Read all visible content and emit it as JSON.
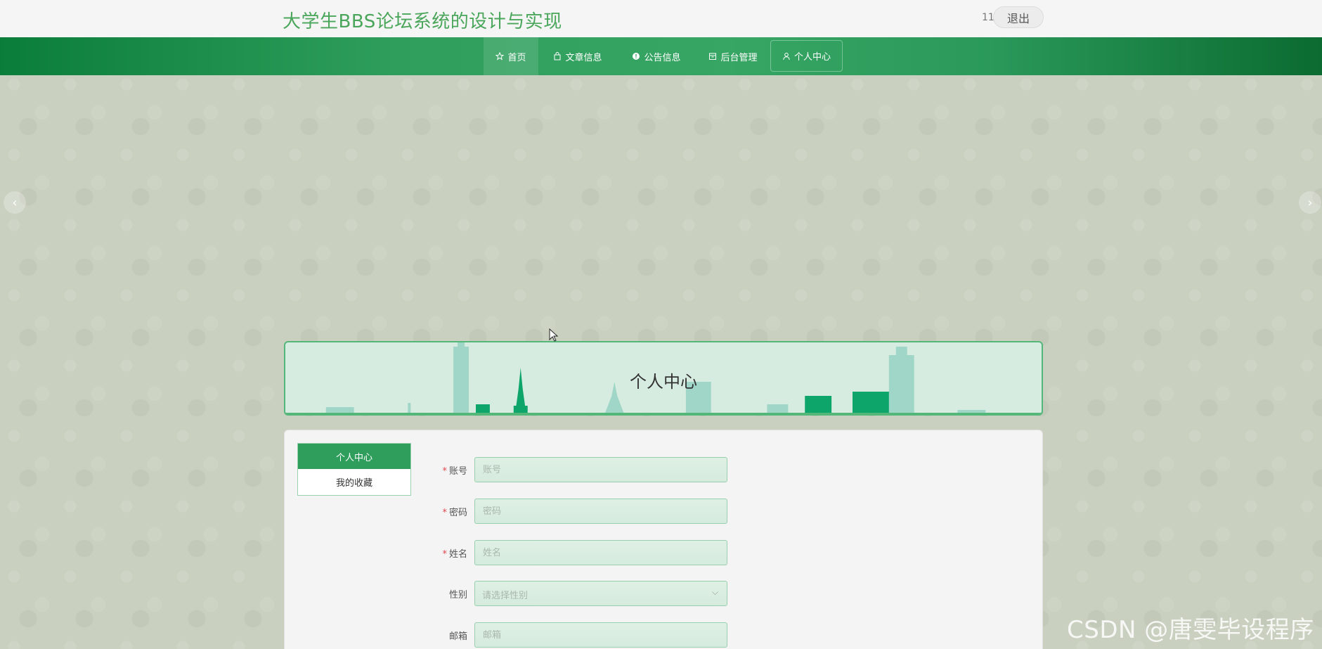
{
  "header": {
    "site_title": "大学生BBS论坛系统的设计与实现",
    "user_num": "11",
    "logout_label": "退出"
  },
  "nav": {
    "items": [
      {
        "label": "首页",
        "icon": "star-icon"
      },
      {
        "label": "文章信息",
        "icon": "bag-icon"
      },
      {
        "label": "公告信息",
        "icon": "info-icon"
      },
      {
        "label": "后台管理",
        "icon": "box-icon"
      },
      {
        "label": "个人中心",
        "icon": "user-icon"
      }
    ]
  },
  "carousel": {
    "prev": "‹",
    "next": "›"
  },
  "banner": {
    "title": "个人中心"
  },
  "side_menu": {
    "items": [
      "个人中心",
      "我的收藏"
    ]
  },
  "form": {
    "account": {
      "label": "账号",
      "placeholder": "账号",
      "required": true
    },
    "password": {
      "label": "密码",
      "placeholder": "密码",
      "required": true
    },
    "name": {
      "label": "姓名",
      "placeholder": "姓名",
      "required": true
    },
    "gender": {
      "label": "性别",
      "placeholder": "请选择性别",
      "required": false
    },
    "email": {
      "label": "邮箱",
      "placeholder": "邮箱",
      "required": false
    }
  },
  "watermark": "CSDN @唐雯毕设程序",
  "colors": {
    "accent": "#2f9e5c",
    "title_green": "#4aa65a",
    "required": "#e0484e"
  }
}
